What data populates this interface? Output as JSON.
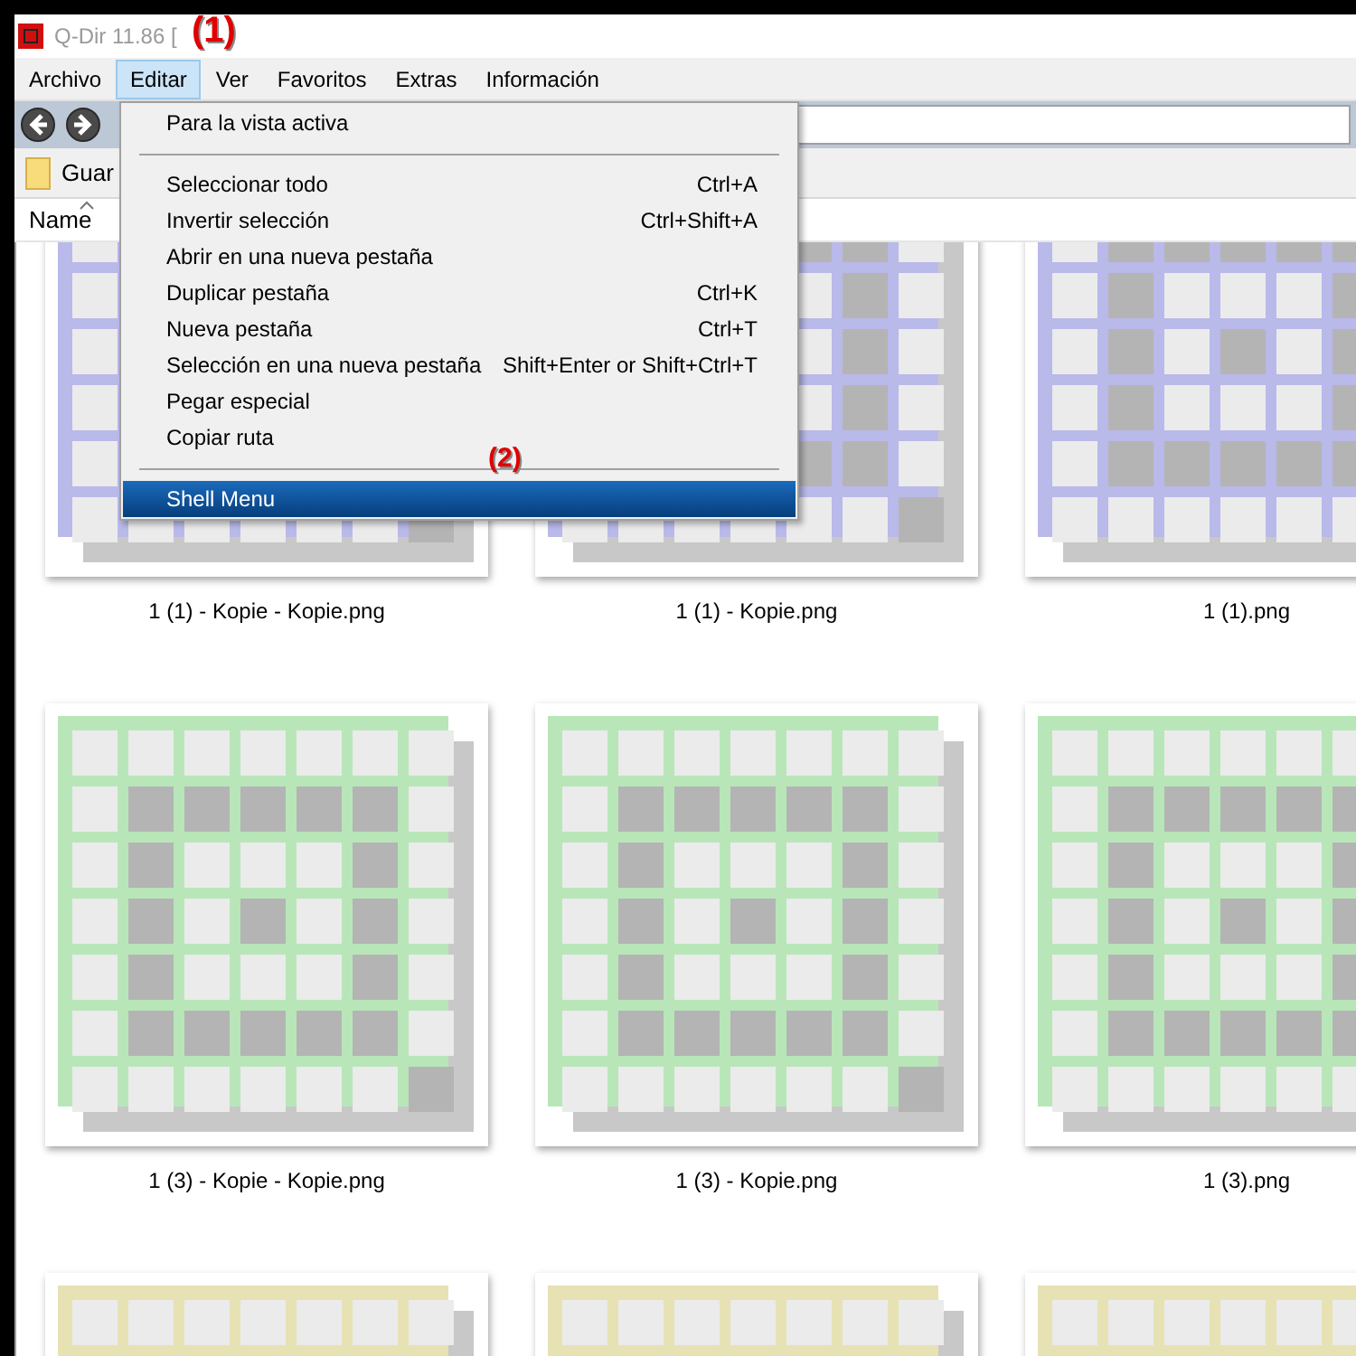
{
  "window": {
    "title": "Q-Dir 11.86 ["
  },
  "menu_bar": [
    {
      "label": "Archivo",
      "selected": false
    },
    {
      "label": "Editar",
      "selected": true
    },
    {
      "label": "Ver",
      "selected": false
    },
    {
      "label": "Favoritos",
      "selected": false
    },
    {
      "label": "Extras",
      "selected": false
    },
    {
      "label": "Información",
      "selected": false
    }
  ],
  "favorites_bar": {
    "label": "Guar"
  },
  "column_header": {
    "label": "Name"
  },
  "dropdown_menu": [
    {
      "kind": "item",
      "label": "Para la vista activa",
      "selected": false
    },
    {
      "kind": "separator"
    },
    {
      "kind": "item",
      "label": "Seleccionar todo",
      "shortcut": "Ctrl+A",
      "selected": false
    },
    {
      "kind": "item",
      "label": "Invertir selección",
      "shortcut": "Ctrl+Shift+A",
      "selected": false
    },
    {
      "kind": "item",
      "label": "Abrir en una nueva pestaña",
      "selected": false
    },
    {
      "kind": "item",
      "label": "Duplicar pestaña",
      "shortcut": "Ctrl+K",
      "selected": false
    },
    {
      "kind": "item",
      "label": "Nueva pestaña",
      "shortcut": "Ctrl+T",
      "selected": false
    },
    {
      "kind": "item",
      "label": "Selección en una nueva pestaña",
      "shortcut": "Shift+Enter or Shift+Ctrl+T",
      "selected": false
    },
    {
      "kind": "item",
      "label": "Pegar especial",
      "selected": false
    },
    {
      "kind": "item",
      "label": "Copiar ruta",
      "selected": false
    },
    {
      "kind": "separator"
    },
    {
      "kind": "item",
      "label": "Shell Menu",
      "selected": true
    }
  ],
  "files": [
    {
      "name": "1 (1) - Kopie - Kopie.png",
      "color": "#b9b9ea"
    },
    {
      "name": "1 (1) - Kopie.png",
      "color": "#b9b9ea"
    },
    {
      "name": "1 (1).png",
      "color": "#b9b9ea"
    },
    {
      "name": "1 (3) - Kopie - Kopie.png",
      "color": "#b8e6b8"
    },
    {
      "name": "1 (3) - Kopie.png",
      "color": "#b8e6b8"
    },
    {
      "name": "1 (3).png",
      "color": "#b8e6b8"
    },
    {
      "color": "#e6e2b4"
    },
    {
      "color": "#e6e2b4"
    },
    {
      "color": "#e6e2b4"
    }
  ],
  "annotations": [
    "(1)",
    "(2)"
  ]
}
